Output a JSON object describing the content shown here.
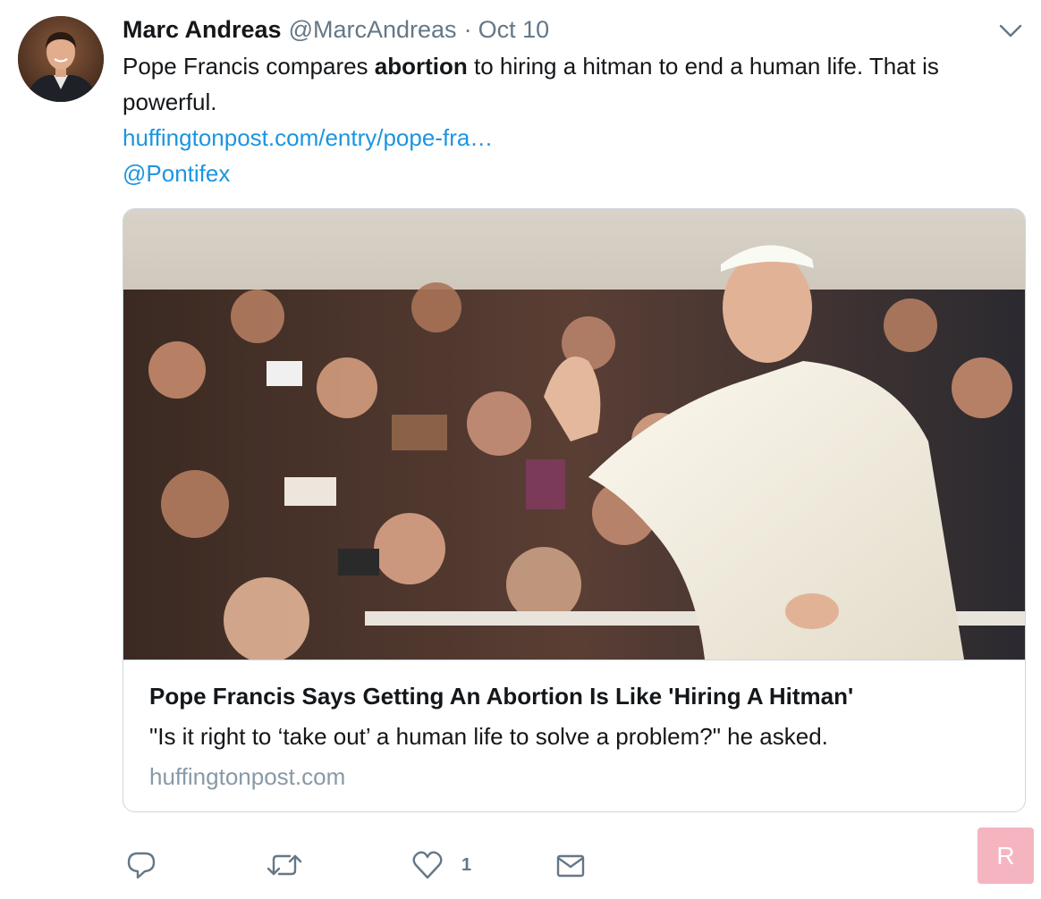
{
  "tweet": {
    "author_name": "Marc Andreas",
    "handle": "@MarcAndreas",
    "separator": "·",
    "date": "Oct 10",
    "text_before": "Pope Francis compares ",
    "text_bold": "abortion",
    "text_after": " to hiring a hitman to end a human life. That is powerful.",
    "link": "huffingtonpost.com/entry/pope-fra…",
    "mention": "@Pontifex"
  },
  "card": {
    "title": "Pope Francis Says Getting An Abortion Is Like 'Hiring A Hitman'",
    "description": "\"Is it right to ‘take out’ a human life to solve a problem?\" he asked.",
    "domain": "huffingtonpost.com"
  },
  "actions": {
    "reply_icon": "reply-icon",
    "retweet_icon": "retweet-icon",
    "like_icon": "heart-icon",
    "like_count": "1",
    "dm_icon": "envelope-icon"
  },
  "badge": {
    "label": "R",
    "color": "#f5b5c0"
  },
  "colors": {
    "link": "#1b95e0",
    "secondary_text": "#657786",
    "border": "#ccd6dd"
  }
}
